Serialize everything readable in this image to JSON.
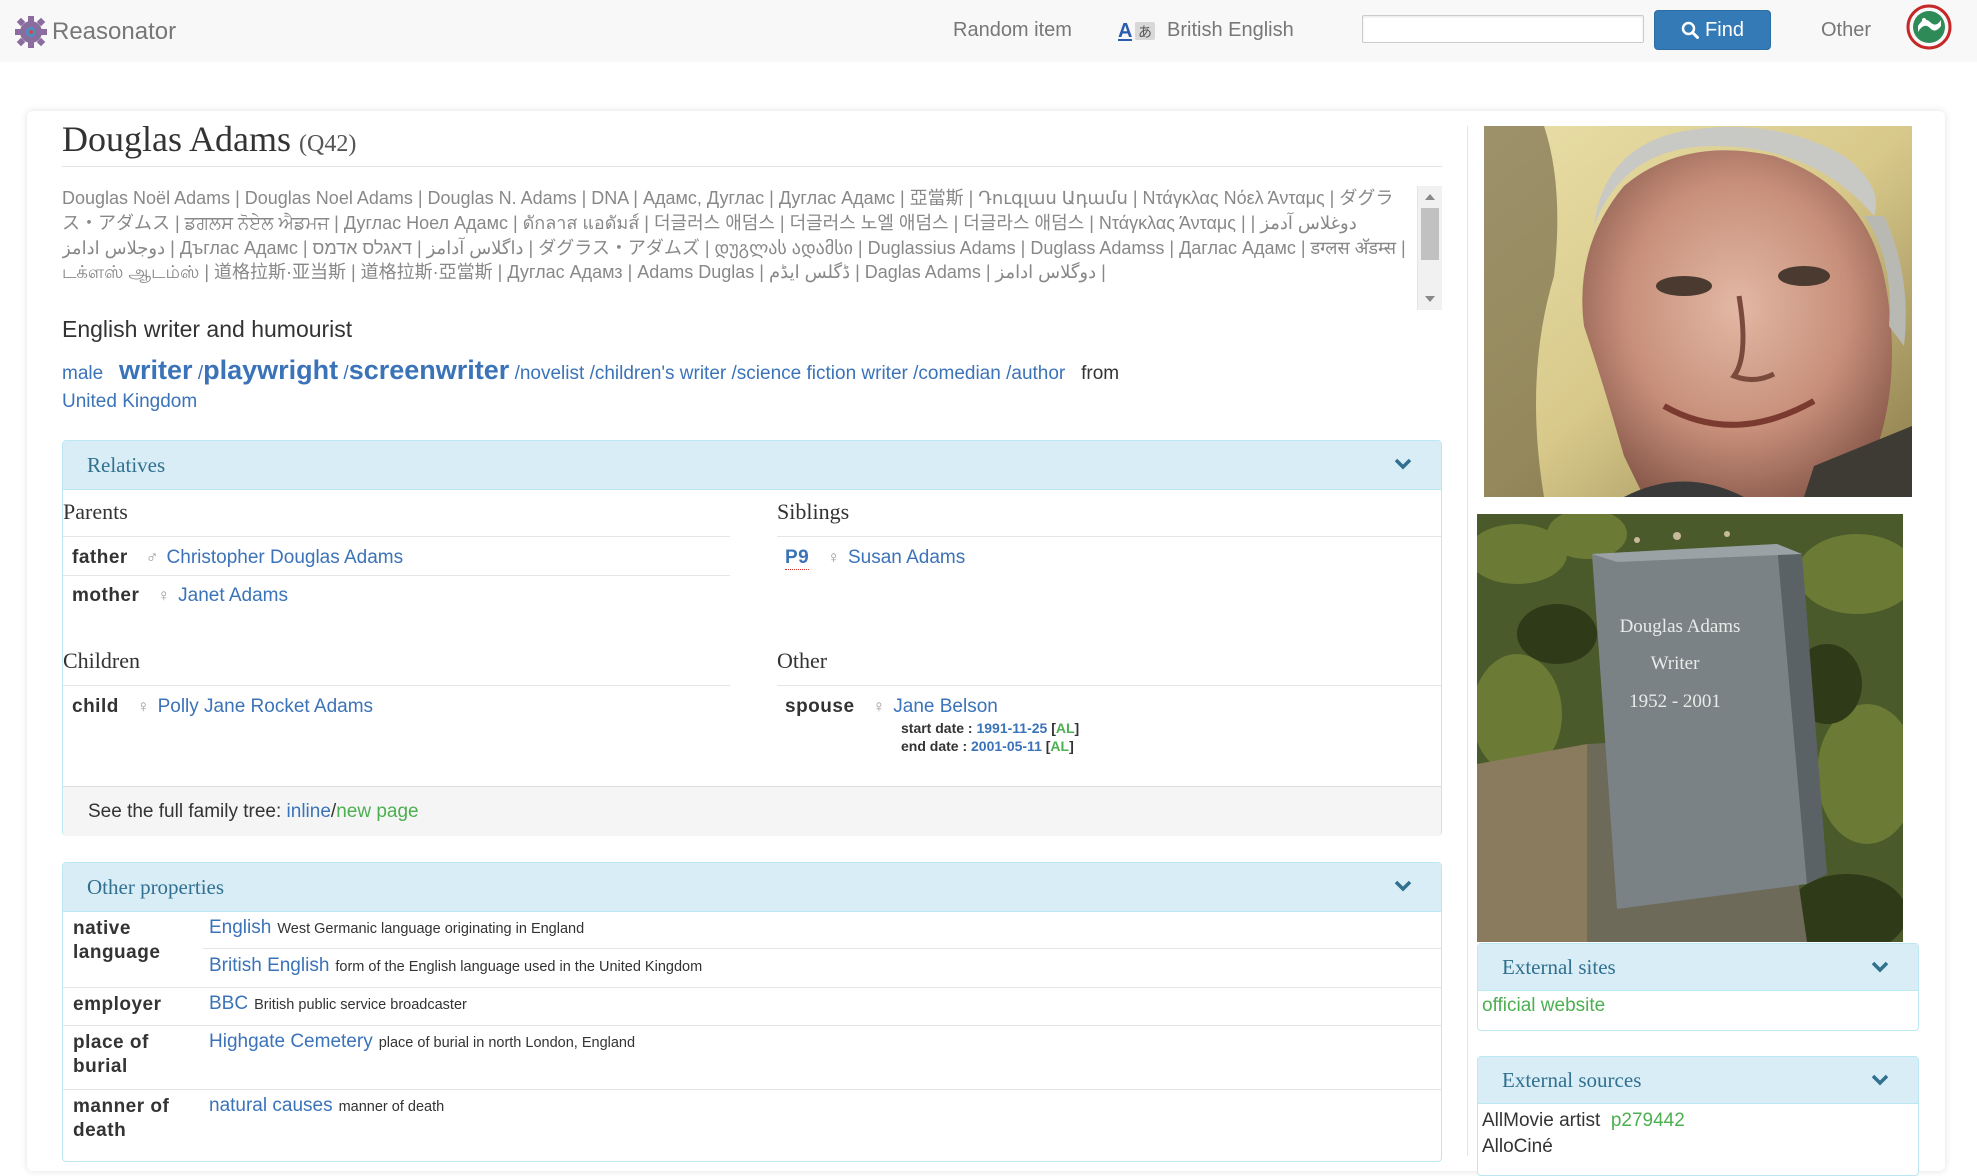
{
  "navbar": {
    "brand": "Reasonator",
    "random_item": "Random item",
    "language": "British English",
    "search_placeholder": "",
    "find": "Find",
    "other": "Other"
  },
  "entity": {
    "title": "Douglas Adams",
    "qid": "(Q42)",
    "aliases": "Douglas Noël Adams | Douglas Noel Adams | Douglas N. Adams | DNA | Адамс, Дуглас | Дуглас Адамс | 亞當斯 | Դուգլաս Ադամս | Ντάγκλας Νόελ Άνταμς | ダグラス・アダムス | ਡਗਲਸ ਨੋਏਲ ਐਡਮਜ | Дуглас Ноел Адамс | ดักลาส แอดัมส์ | 더글러스 애덤스 | 더글러스 노엘 애덤스 | 더글라스 애덤스 | Ντάγκλας Άνταμς | دوغلاس آدمز | دوجلاس ادامز | Дъглас Адамс | داگلاس آدامز | דאגלס אדמס | ダグラス・アダムズ | დუგლას ადამსი | Duglassius Adams | Duglass Adamss | Даглас Адамс | डग्लस अ‍ॅडम्स | டக்ளஸ் ஆடம்ஸ் | 道格拉斯·亚当斯 | 道格拉斯·亞當斯 | Дуглас Адамз | Adams Duglas | ڈگلس ایڈم | Daglas Adams | دوگلاس ادامز |",
    "description": "English writer and humourist"
  },
  "occupations": {
    "gender": "male",
    "big": [
      "writer",
      "playwright",
      "screenwriter"
    ],
    "small": [
      "novelist",
      "children's writer",
      "science fiction writer",
      "comedian",
      "author"
    ],
    "from_label": "from",
    "country": "United Kingdom"
  },
  "relatives": {
    "heading": "Relatives",
    "parents_title": "Parents",
    "siblings_title": "Siblings",
    "children_title": "Children",
    "other_title": "Other",
    "father_label": "father",
    "father_value": "Christopher Douglas Adams",
    "mother_label": "mother",
    "mother_value": "Janet Adams",
    "sibling_label": "P9",
    "sibling_value": "Susan Adams",
    "child_label": "child",
    "child_value": "Polly Jane Rocket Adams",
    "spouse_label": "spouse",
    "spouse_value": "Jane Belson",
    "start_label": "start date :",
    "start_value": "1991-11-25",
    "end_label": "end date :",
    "end_value": "2001-05-11",
    "al": "AL",
    "tree_text": "See the full family tree:",
    "tree_inline": "inline",
    "tree_new": "new page"
  },
  "other_properties": {
    "heading": "Other properties",
    "rows": [
      {
        "label": "native language",
        "value": "English",
        "desc": "West Germanic language originating in England"
      },
      {
        "label": "",
        "value": "British English",
        "desc": "form of the English language used in the United Kingdom"
      },
      {
        "label": "employer",
        "value": "BBC",
        "desc": "British public service broadcaster"
      },
      {
        "label": "place of burial",
        "value": "Highgate Cemetery",
        "desc": "place of burial in north London, England"
      },
      {
        "label": "manner of death",
        "value": "natural causes",
        "desc": "manner of death"
      }
    ]
  },
  "sidebar": {
    "grave_lines": [
      "Douglas Adams",
      "Writer",
      "1952 - 2001"
    ],
    "external_sites_heading": "External sites",
    "official_website": "official website",
    "external_sources_heading": "External sources",
    "allmovie_label": "AllMovie artist",
    "allmovie_value": "p279442",
    "allocine_label": "AlloCiné"
  },
  "colors": {
    "link": "#3b73b9",
    "panel_heading_bg": "#d9edf7",
    "panel_heading_text": "#31708f",
    "find_button": "#337ab7",
    "green_link": "#4caf50"
  }
}
